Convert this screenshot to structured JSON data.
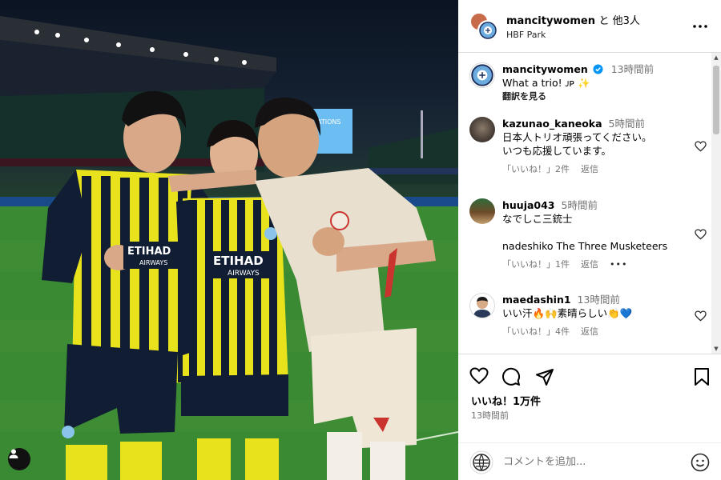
{
  "header": {
    "account": "mancitywomen",
    "with_others": "と 他3人",
    "location": "HBF Park"
  },
  "caption": {
    "username": "mancitywomen",
    "time": "13時間前",
    "text": "What a trio! ᴊᴘ ✨",
    "translate": "翻訳を見る"
  },
  "comments": [
    {
      "username": "kazunao_kaneoka",
      "time": "5時間前",
      "lines": [
        "日本人トリオ頑張ってください。",
        "いつも応援しています。"
      ],
      "likes": "「いいね！」2件",
      "reply": "返信"
    },
    {
      "username": "huuja043",
      "time": "5時間前",
      "lines": [
        "なでしこ三銃士",
        "",
        "nadeshiko The Three Musketeers"
      ],
      "likes": "「いいね！」1件",
      "reply": "返信",
      "more": "•••"
    },
    {
      "username": "maedashin1",
      "time": "13時間前",
      "lines": [
        "いい汗🔥🙌素晴らしい👏💙"
      ],
      "likes": "「いいね！」4件",
      "reply": "返信"
    }
  ],
  "footer": {
    "likes_count": "いいね！1万件",
    "post_time": "13時間前",
    "comment_placeholder": "コメントを追加..."
  },
  "photo": {
    "jersey_sponsor": "ETIHAD",
    "jersey_sponsor_sub": "AIRWAYS",
    "jersey_sponsor_left": "ETIHAD",
    "jersey_sponsor_left_sub": "AIRWAYS",
    "board_text": "ATIONS"
  },
  "colors": {
    "kit_yellow": "#e8e21c",
    "kit_navy": "#101d33",
    "away_kit": "#e8dfcf",
    "verified_blue": "#0095f6"
  }
}
